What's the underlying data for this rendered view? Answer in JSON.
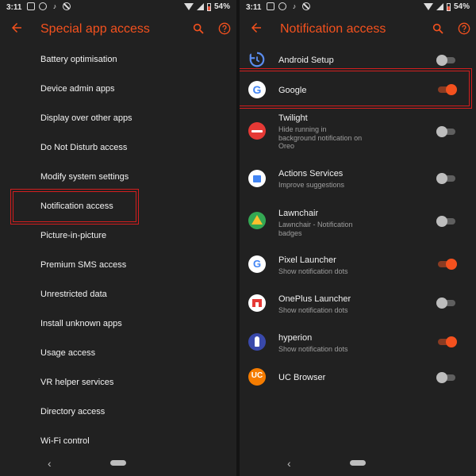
{
  "status_bar": {
    "time": "3:11",
    "battery": "54%"
  },
  "left": {
    "title": "Special app access",
    "items": [
      "Battery optimisation",
      "Device admin apps",
      "Display over other apps",
      "Do Not Disturb access",
      "Modify system settings",
      "Notification access",
      "Picture-in-picture",
      "Premium SMS access",
      "Unrestricted data",
      "Install unknown apps",
      "Usage access",
      "VR helper services",
      "Directory access",
      "Wi-Fi control"
    ]
  },
  "right": {
    "title": "Notification access",
    "apps": [
      {
        "name": "Android Setup",
        "subtitle": "",
        "enabled": false
      },
      {
        "name": "Google",
        "subtitle": "",
        "enabled": true
      },
      {
        "name": "Twilight",
        "subtitle": "Hide running in background notification on Oreo",
        "enabled": false
      },
      {
        "name": "Actions Services",
        "subtitle": "Improve suggestions",
        "enabled": false
      },
      {
        "name": "Lawnchair",
        "subtitle": "Lawnchair - Notification badges",
        "enabled": false
      },
      {
        "name": "Pixel Launcher",
        "subtitle": "Show notification dots",
        "enabled": true
      },
      {
        "name": "OnePlus Launcher",
        "subtitle": "Show notification dots",
        "enabled": false
      },
      {
        "name": "hyperion",
        "subtitle": "Show notification dots",
        "enabled": true
      },
      {
        "name": "UC Browser",
        "subtitle": "",
        "enabled": false
      }
    ]
  },
  "colors": {
    "accent": "#f4511e",
    "background": "#212121",
    "highlight": "#d31e1e"
  },
  "icons": {
    "back": "arrow-left-icon",
    "search": "search-icon",
    "help": "help-icon",
    "nav_back": "chevron-left-icon"
  }
}
